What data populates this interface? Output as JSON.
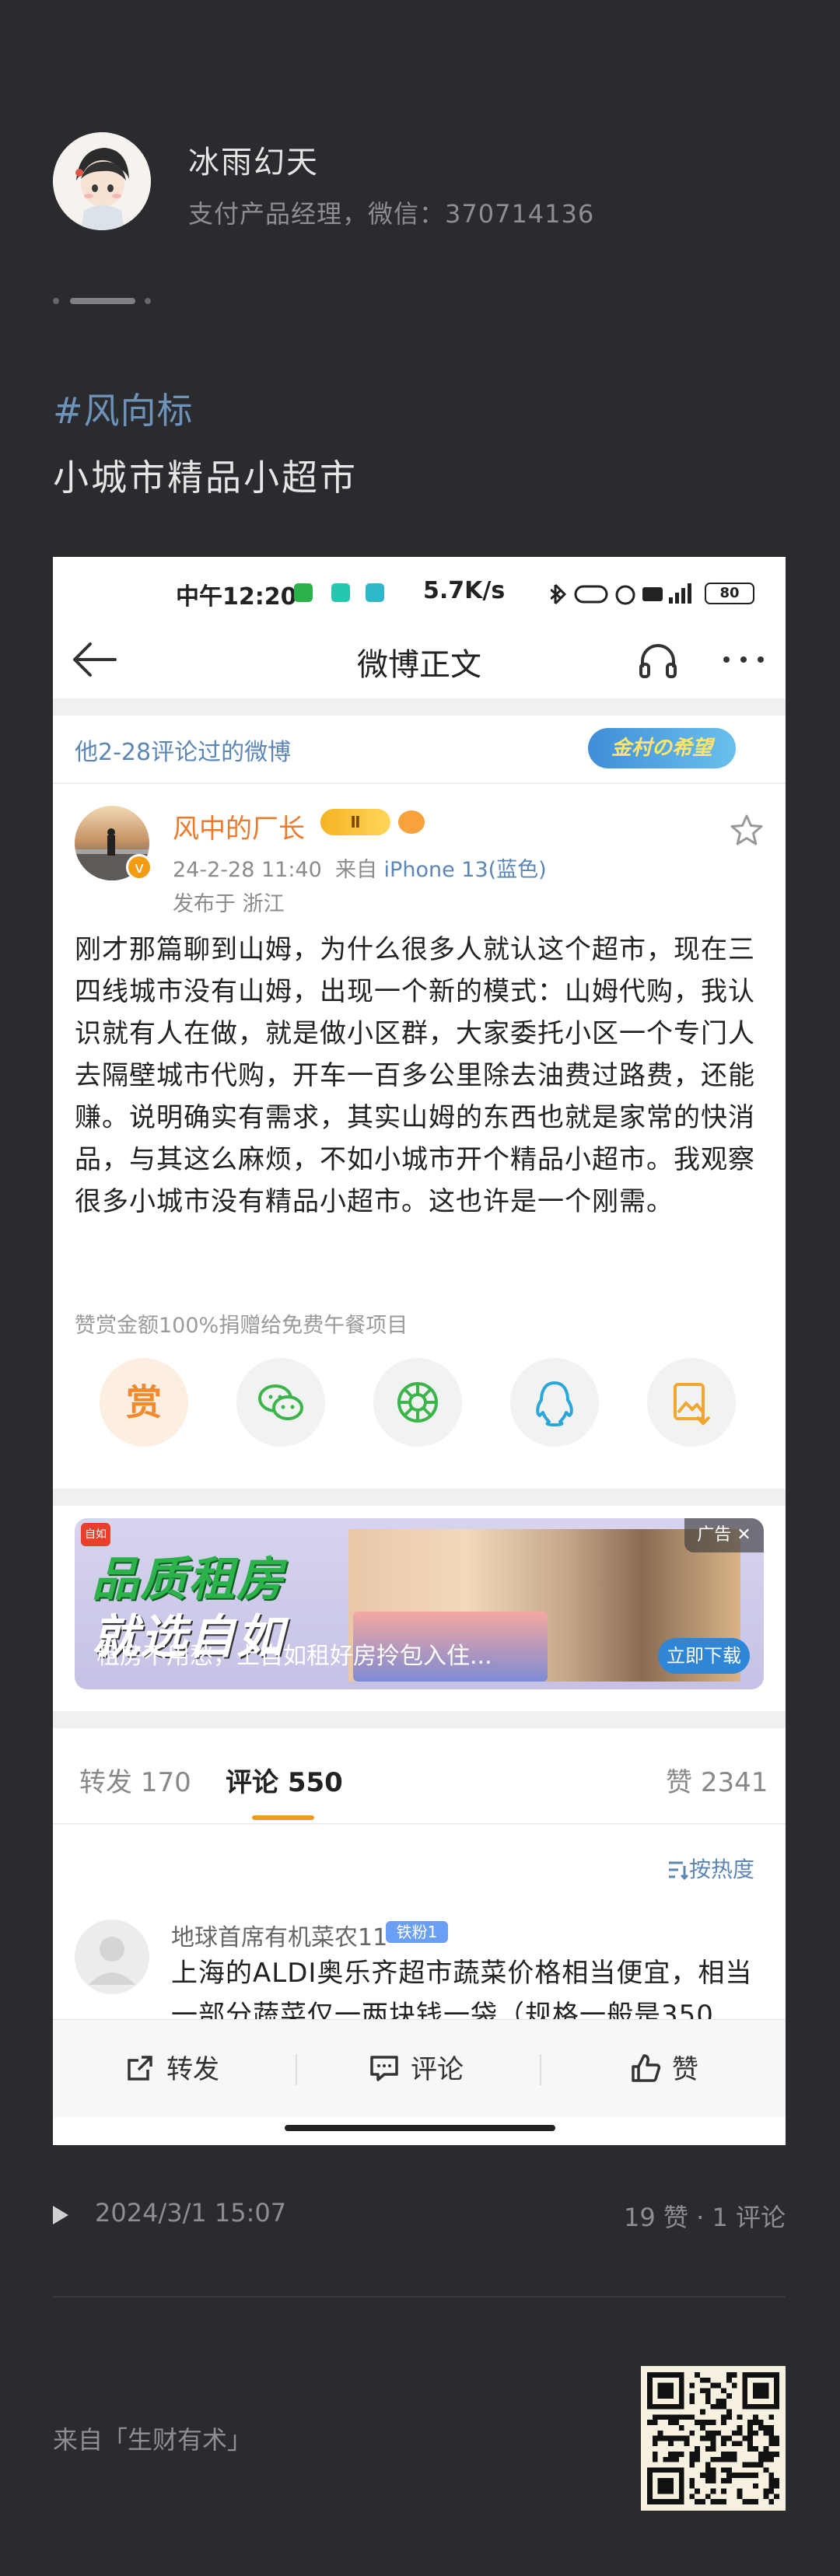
{
  "author": {
    "name": "冰雨幻天",
    "bio": "支付产品经理，微信：370714136"
  },
  "post": {
    "hashtag": "#风向标",
    "title": "小城市精品小超市"
  },
  "screenshot": {
    "status_bar": {
      "time": "中午12:20",
      "net_speed": "5.7K/s",
      "battery": "80"
    },
    "nav": {
      "title": "微博正文"
    },
    "reply_strip": {
      "text": "他2-28评论过的微博",
      "badge": "金村の希望"
    },
    "weibo": {
      "user": "风中的厂长",
      "level_badge": "Ⅱ",
      "time": "24-2-28 11:40",
      "source_label": "来自",
      "device": "iPhone 13(蓝色)",
      "location": "发布于 浙江",
      "body": "刚才那篇聊到山姆，为什么很多人就认这个超市，现在三四线城市没有山姆，出现一个新的模式：山姆代购，我认识就有人在做，就是做小区群，大家委托小区一个专门人去隔壁城市代购，开车一百多公里除去油费过路费，还能赚。说明确实有需求，其实山姆的东西也就是家常的快消品，与其这么麻烦，不如小城市开个精品小超市。我观察很多小城市没有精品小超市。这也许是一个刚需。",
      "donate_note": "赞赏金额100%捐赠给免费午餐项目",
      "reward_label": "赏"
    },
    "ad": {
      "logo": "自如",
      "headline1": "品质租房",
      "headline2": "就选自如",
      "caption": "租房不用愁，上自如租好房拎包入住...",
      "tag": "广告 ✕",
      "download": "立即下载"
    },
    "tabs": {
      "repost_label": "转发",
      "repost_count": "170",
      "comment_label": "评论",
      "comment_count": "550",
      "like_label": "赞",
      "like_count": "2341"
    },
    "sort_label": "按热度",
    "comment": {
      "user": "地球首席有机菜农11",
      "fan_badge": "铁粉1",
      "text": "上海的ALDI奥乐齐超市蔬菜价格相当便宜，相当一部分蔬菜仅一两块钱一袋（规格一般是350"
    },
    "actions": {
      "repost": "转发",
      "comment": "评论",
      "like": "赞"
    }
  },
  "footer": {
    "date": "2024/3/1 15:07",
    "stats": "19 赞 · 1 评论",
    "source": "来自「生财有术」"
  },
  "colors": {
    "page_bg": "#2a2b2f",
    "hashtag": "#6f93b8",
    "weibo_orange": "#eb7a2d",
    "link_blue": "#5b86b6",
    "tab_underline": "#f09a1c"
  },
  "icons": [
    "back-arrow-icon",
    "headphone-icon",
    "more-icon",
    "star-icon",
    "reward-icon",
    "wechat-icon",
    "moments-icon",
    "qq-icon",
    "save-image-icon",
    "share-icon",
    "comment-icon",
    "like-icon",
    "sort-icon",
    "play-icon",
    "qr-code"
  ]
}
